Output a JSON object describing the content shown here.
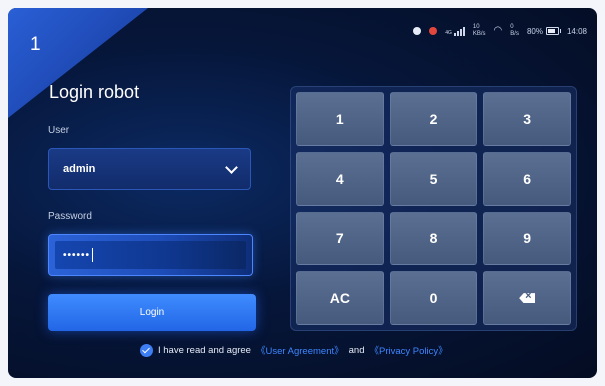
{
  "step": "1",
  "status_bar": {
    "net_type": "4G",
    "upload_speed": "10",
    "upload_unit": "KB/s",
    "download_speed": "0",
    "download_unit": "B/s",
    "battery": "80%",
    "time": "14:08",
    "icons": [
      "record-icon",
      "location-icon",
      "signal-icon",
      "wifi-icon",
      "battery-icon"
    ]
  },
  "title": "Login robot",
  "user": {
    "label": "User",
    "value": "admin"
  },
  "password": {
    "label": "Password",
    "value": "••••••"
  },
  "login_button": "Login",
  "agreement": {
    "prefix": "I have read and agree",
    "user_agreement": "《User Agreement》",
    "and": "and",
    "privacy_policy": "《Privacy Policy》",
    "checked": true
  },
  "keypad": {
    "keys": [
      "1",
      "2",
      "3",
      "4",
      "5",
      "6",
      "7",
      "8",
      "9",
      "AC",
      "0"
    ],
    "backspace_icon": "backspace-icon"
  },
  "colors": {
    "accent": "#2266e6",
    "link": "#3d86ff",
    "background": "#06163a"
  }
}
